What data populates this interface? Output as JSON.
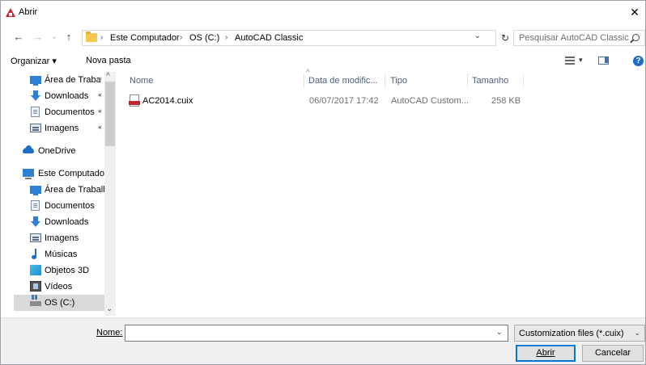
{
  "window": {
    "title": "Abrir",
    "close_glyph": "✕"
  },
  "nav": {
    "back_glyph": "←",
    "forward_glyph": "→",
    "recent_glyph": "⌄",
    "up_glyph": "↑",
    "breadcrumb": [
      "Este Computador",
      "OS (C:)",
      "AutoCAD Classic"
    ],
    "breadcrumb_sep": "›",
    "lead_sep": "›",
    "dropdown_glyph": "⌄",
    "refresh_glyph": "↻"
  },
  "search": {
    "placeholder": "Pesquisar AutoCAD Classic"
  },
  "toolbar": {
    "organize_label": "Organizar ▾",
    "new_folder_label": "Nova pasta",
    "view_dropdown_glyph": "▾",
    "help_glyph": "?"
  },
  "sidebar": {
    "pin_glyph": "✶",
    "items": [
      {
        "label": "Área de Traba",
        "icon": "desktop-icon",
        "pinned": true
      },
      {
        "label": "Downloads",
        "icon": "download-icon",
        "pinned": true
      },
      {
        "label": "Documentos",
        "icon": "document-icon",
        "pinned": true
      },
      {
        "label": "Imagens",
        "icon": "pictures-icon",
        "pinned": true
      },
      {
        "label": "OneDrive",
        "icon": "onedrive-icon",
        "pinned": false
      },
      {
        "label": "Este Computador",
        "icon": "computer-icon",
        "pinned": false
      },
      {
        "label": "Área de Trabalho",
        "icon": "desktop-icon",
        "pinned": false
      },
      {
        "label": "Documentos",
        "icon": "document-icon",
        "pinned": false
      },
      {
        "label": "Downloads",
        "icon": "download-icon",
        "pinned": false
      },
      {
        "label": "Imagens",
        "icon": "pictures-icon",
        "pinned": false
      },
      {
        "label": "Músicas",
        "icon": "music-icon",
        "pinned": false
      },
      {
        "label": "Objetos 3D",
        "icon": "objects-3d-icon",
        "pinned": false
      },
      {
        "label": "Vídeos",
        "icon": "videos-icon",
        "pinned": false
      },
      {
        "label": "OS (C:)",
        "icon": "drive-icon",
        "pinned": false,
        "selected": true
      }
    ],
    "scroll_up_glyph": "^",
    "scroll_down_glyph": "⌄"
  },
  "filelist": {
    "sort_glyph": "^",
    "columns": [
      "Nome",
      "Data de modific...",
      "Tipo",
      "Tamanho"
    ],
    "rows": [
      {
        "name": "AC2014.cuix",
        "modified": "06/07/2017 17:42",
        "type": "AutoCAD Custom...",
        "size": "258 KB",
        "icon": "cuix-file-icon"
      }
    ]
  },
  "footer": {
    "name_label": "Nome:",
    "name_value": "",
    "name_dropdown_glyph": "⌄",
    "filetype_value": "Customization files (*.cuix)",
    "filetype_dropdown_glyph": "⌄",
    "open_label": "Abrir",
    "cancel_label": "Cancelar"
  },
  "colors": {
    "accent": "#0078d7",
    "autocad_red": "#d4202a",
    "selection": "#d9d9d9"
  }
}
